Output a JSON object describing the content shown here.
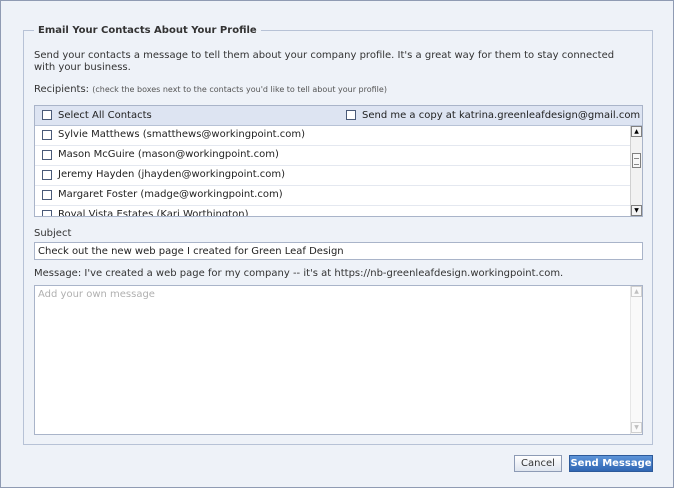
{
  "panel": {
    "legend": "Email Your Contacts About Your Profile",
    "intro": "Send your contacts a message to tell them about your company profile. It's a great way for them to stay connected with your business."
  },
  "recipients": {
    "label": "Recipients:",
    "hint": "(check the boxes next to the contacts you'd like to tell about your profile)",
    "select_all_label": "Select All Contacts",
    "copy_label": "Send me a copy at katrina.greenleafdesign@gmail.com",
    "contacts": [
      "Sylvie Matthews (smatthews@workingpoint.com)",
      "Mason McGuire (mason@workingpoint.com)",
      "Jeremy Hayden (jhayden@workingpoint.com)",
      "Margaret Foster (madge@workingpoint.com)",
      "Royal Vista Estates (Kari Worthington)"
    ]
  },
  "subject": {
    "label": "Subject",
    "value": "Check out the new web page I created for Green Leaf Design"
  },
  "message": {
    "label": "Message: I've created a web page for my company -- it's at https://nb-greenleafdesign.workingpoint.com.",
    "placeholder": "Add your own message"
  },
  "buttons": {
    "cancel": "Cancel",
    "send": "Send Message"
  },
  "colors": {
    "background": "#eef2f8",
    "header_row": "#dde4f2",
    "send_button": "#2f66b3"
  }
}
